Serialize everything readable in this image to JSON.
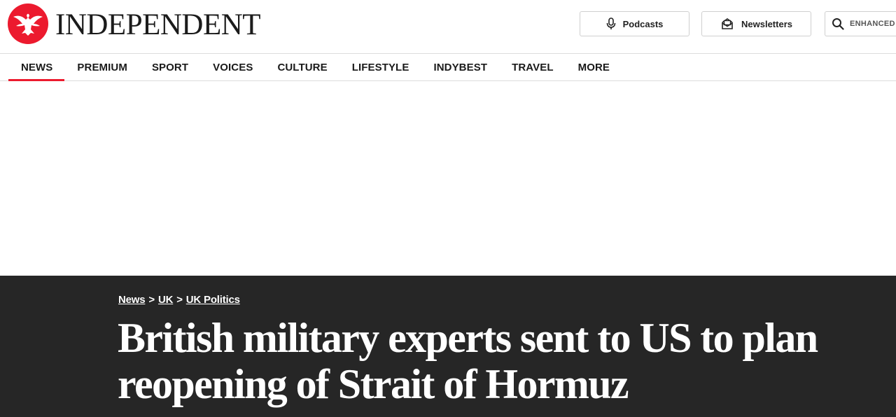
{
  "header": {
    "logo_text": "INDEPENDENT",
    "brand_color": "#ec1a2e",
    "podcasts_label": "Podcasts",
    "newsletters_label": "Newsletters",
    "search_label": "ENHANCED I",
    "icons": {
      "podcasts": "microphone-icon",
      "newsletters": "mail-icon",
      "search": "search-icon",
      "logo": "eagle-logo-icon"
    }
  },
  "nav": {
    "items": [
      {
        "label": "NEWS",
        "active": true
      },
      {
        "label": "PREMIUM"
      },
      {
        "label": "SPORT"
      },
      {
        "label": "VOICES"
      },
      {
        "label": "CULTURE"
      },
      {
        "label": "LIFESTYLE"
      },
      {
        "label": "INDYBEST"
      },
      {
        "label": "TRAVEL"
      },
      {
        "label": "MORE"
      }
    ]
  },
  "article": {
    "breadcrumb": [
      {
        "label": "News"
      },
      {
        "label": "UK"
      },
      {
        "label": "UK Politics"
      }
    ],
    "breadcrumb_separator": ">",
    "headline_line1": "British military experts sent to US to plan",
    "headline_line2": "reopening of Strait of Hormuz",
    "hero_background": "#262626"
  }
}
